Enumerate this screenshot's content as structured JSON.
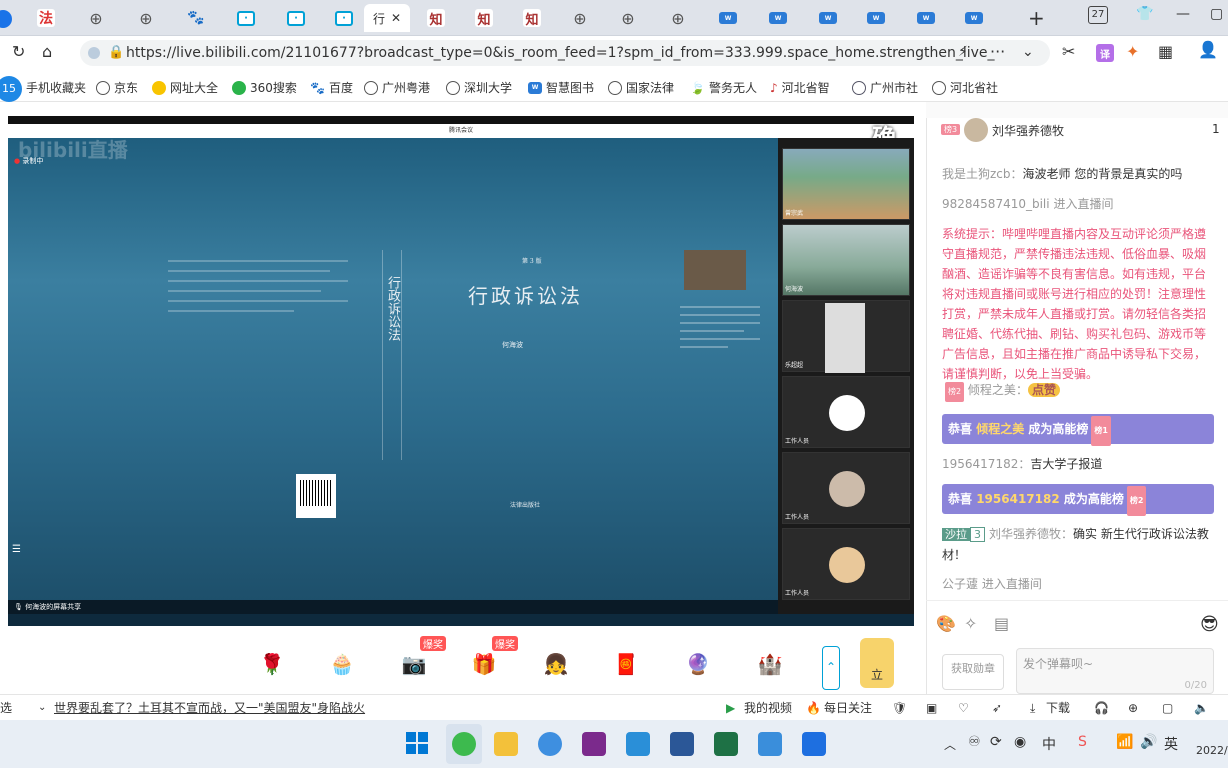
{
  "tabs": [
    {
      "label": "法",
      "active": false
    },
    {
      "label": "",
      "active": false
    },
    {
      "label": "",
      "active": false
    },
    {
      "label": "",
      "active": false
    },
    {
      "label": "",
      "active": false
    },
    {
      "label": "",
      "active": false
    },
    {
      "label": "",
      "active": false
    },
    {
      "label": "行",
      "active": true
    },
    {
      "label": "知",
      "active": false
    },
    {
      "label": "知",
      "active": false
    },
    {
      "label": "知",
      "active": false
    },
    {
      "label": "",
      "active": false
    },
    {
      "label": "",
      "active": false
    },
    {
      "label": "",
      "active": false
    },
    {
      "label": "",
      "active": false
    },
    {
      "label": "",
      "active": false
    },
    {
      "label": "",
      "active": false
    },
    {
      "label": "",
      "active": false
    },
    {
      "label": "",
      "active": false
    },
    {
      "label": "",
      "active": false
    }
  ],
  "tab_count": "27",
  "address": {
    "url": "https://live.bilibili.com/21101677?broadcast_type=0&is_room_feed=1?spm_id_from=333.999.space_home.strengthen_live_"
  },
  "bookmarks": [
    "手机收藏夹",
    "京东",
    "网址大全",
    "360搜索",
    "百度",
    "广州粤港",
    "深圳大学",
    "智慧图书",
    "国家法律",
    "警务无人",
    "河北省智",
    "广州市社",
    "河北省社"
  ],
  "badge_15": "15",
  "video": {
    "meeting_title": "腾讯会议",
    "bili_logo": "bilibili直播",
    "recording": "录制中",
    "watermark": "确",
    "share_label": "何海波的屏幕共享",
    "book_title": "行政诉讼法",
    "edition": "第 3 版",
    "author": "何海波",
    "spine_title": "行政诉讼法",
    "publisher": "法律出版社"
  },
  "participants": [
    {
      "name": "曾宗武"
    },
    {
      "name": "何海波"
    },
    {
      "name": "乐超超"
    },
    {
      "name": "工作人员"
    },
    {
      "name": "工作人员"
    },
    {
      "name": "工作人员"
    }
  ],
  "gifts": [
    "",
    "",
    "",
    "",
    "",
    "",
    "",
    "",
    ""
  ],
  "hot_labels": [
    "爆奖",
    "爆奖"
  ],
  "gift_side_label": "立",
  "chat": {
    "top_user": {
      "rank": "榜3",
      "name": "刘华强养德牧",
      "count": "1"
    },
    "messages": [
      {
        "user": "我是土狗zcb",
        "text": "海波老师 您的背景是真实的吗"
      },
      {
        "user": "98284587410_bili",
        "text": "进入直播间"
      }
    ],
    "system_notice": "系统提示：哔哩哔哩直播内容及互动评论须严格遵守直播规范，严禁传播违法违规、低俗血暴、吸烟酗酒、造谣诈骗等不良有害信息。如有违规，平台将对违规直播间或账号进行相应的处罚！注意理性打赏，严禁未成年人直播或打赏。请勿轻信各类招聘征婚、代练代抽、刷钻、购买礼包码、游戏币等广告信息，且如主播在推广商品中诱导私下交易，请谨慎判断，以免上当受骗。",
    "like_user": {
      "badge": "榜2",
      "name": "倾程之美",
      "action": "点赞"
    },
    "banner1": {
      "prefix": "恭喜",
      "name": "倾程之美",
      "suffix": "成为高能榜",
      "rank": "榜1"
    },
    "msg3": {
      "user": "1956417182",
      "text": "吉大学子报道"
    },
    "banner2": {
      "prefix": "恭喜",
      "name": "1956417182",
      "suffix": "成为高能榜",
      "rank": "榜2"
    },
    "msg4": {
      "medal": "沙拉",
      "level": "3",
      "user": "刘华强养德牧",
      "text": "确实 新生代行政诉讼法教材！"
    },
    "msg5": {
      "user": "公子蘧",
      "text": "进入直播间"
    },
    "medal_button": "获取勋章",
    "input_placeholder": "发个弹幕呗~",
    "char_count": "0/20"
  },
  "status": {
    "left_cut": "选",
    "news": "世界要乱套了？土耳其不宣而战，又一\"美国盟友\"身陷战火",
    "my_video": "我的视频",
    "daily": "每日关注",
    "download": "下载"
  },
  "clock": {
    "year": "2022/"
  }
}
